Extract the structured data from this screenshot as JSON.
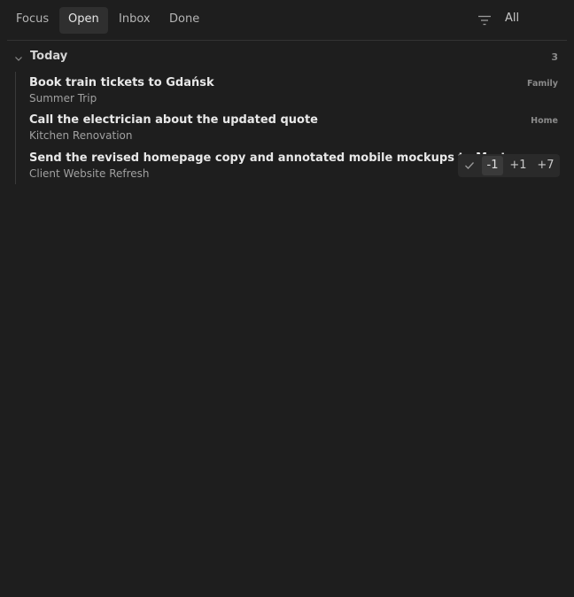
{
  "tabs": [
    {
      "label": "Focus"
    },
    {
      "label": "Open"
    },
    {
      "label": "Inbox"
    },
    {
      "label": "Done"
    }
  ],
  "active_tab": "Open",
  "filter": {
    "icon": "filter-icon",
    "value": "All"
  },
  "group": {
    "title": "Today",
    "count": "3",
    "icon": "chevron-down-icon",
    "tasks": [
      {
        "title": "Book train tickets to Gdańsk",
        "project": "Summer Trip",
        "tag": "Family"
      },
      {
        "title": "Call the electrician about the updated quote",
        "project": "Kitchen Renovation",
        "tag": "Home"
      },
      {
        "title": "Send the revised homepage copy and annotated mobile mockups to Marta",
        "project": "Client Website Refresh",
        "tag": ""
      }
    ]
  },
  "quick_actions": {
    "check_icon": "check-icon",
    "minus_one": "-1",
    "plus_one": "+1",
    "plus_seven": "+7"
  },
  "colors": {
    "background": "#1e1e1e",
    "active_tab_bg": "#2f2f2f",
    "text_primary": "#e8e8e8",
    "text_secondary": "#a0a0a0"
  }
}
